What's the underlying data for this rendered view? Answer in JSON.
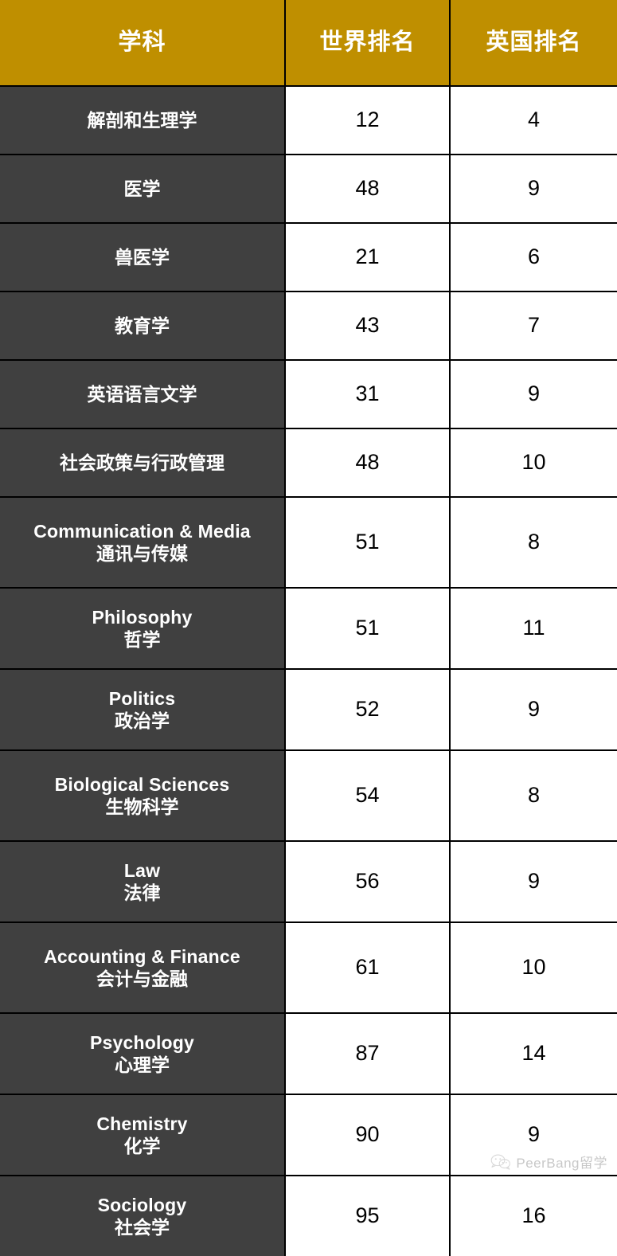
{
  "table": {
    "columns": [
      {
        "key": "subject",
        "label": "学科"
      },
      {
        "key": "world_rank",
        "label": "世界排名"
      },
      {
        "key": "uk_rank",
        "label": "英国排名"
      }
    ],
    "rows": [
      {
        "en": "",
        "zh": "解剖和生理学",
        "world_rank": "12",
        "uk_rank": "4"
      },
      {
        "en": "",
        "zh": "医学",
        "world_rank": "48",
        "uk_rank": "9"
      },
      {
        "en": "",
        "zh": "兽医学",
        "world_rank": "21",
        "uk_rank": "6"
      },
      {
        "en": "",
        "zh": "教育学",
        "world_rank": "43",
        "uk_rank": "7"
      },
      {
        "en": "",
        "zh": "英语语言文学",
        "world_rank": "31",
        "uk_rank": "9"
      },
      {
        "en": "",
        "zh": "社会政策与行政管理",
        "world_rank": "48",
        "uk_rank": "10"
      },
      {
        "en": "Communication & Media",
        "zh": "通讯与传媒",
        "world_rank": "51",
        "uk_rank": "8"
      },
      {
        "en": "Philosophy",
        "zh": "哲学",
        "world_rank": "51",
        "uk_rank": "11"
      },
      {
        "en": "Politics",
        "zh": "政治学",
        "world_rank": "52",
        "uk_rank": "9"
      },
      {
        "en": "Biological Sciences",
        "zh": "生物科学",
        "world_rank": "54",
        "uk_rank": "8"
      },
      {
        "en": "Law",
        "zh": "法律",
        "world_rank": "56",
        "uk_rank": "9"
      },
      {
        "en": "Accounting & Finance",
        "zh": "会计与金融",
        "world_rank": "61",
        "uk_rank": "10"
      },
      {
        "en": "Psychology",
        "zh": "心理学",
        "world_rank": "87",
        "uk_rank": "14"
      },
      {
        "en": "Chemistry",
        "zh": "化学",
        "world_rank": "90",
        "uk_rank": "9"
      },
      {
        "en": "Sociology",
        "zh": "社会学",
        "world_rank": "95",
        "uk_rank": "16"
      }
    ]
  },
  "watermark": {
    "icon": "wechat-icon",
    "text": "PeerBang留学"
  },
  "colors": {
    "header_background": "#BF8F00",
    "header_text": "#FFFFFF",
    "subject_background": "#404040",
    "subject_text": "#FFFFFF",
    "rank_background": "#FFFFFF",
    "rank_text": "#000000",
    "border": "#000000",
    "watermark_text": "#9A9A9A"
  }
}
